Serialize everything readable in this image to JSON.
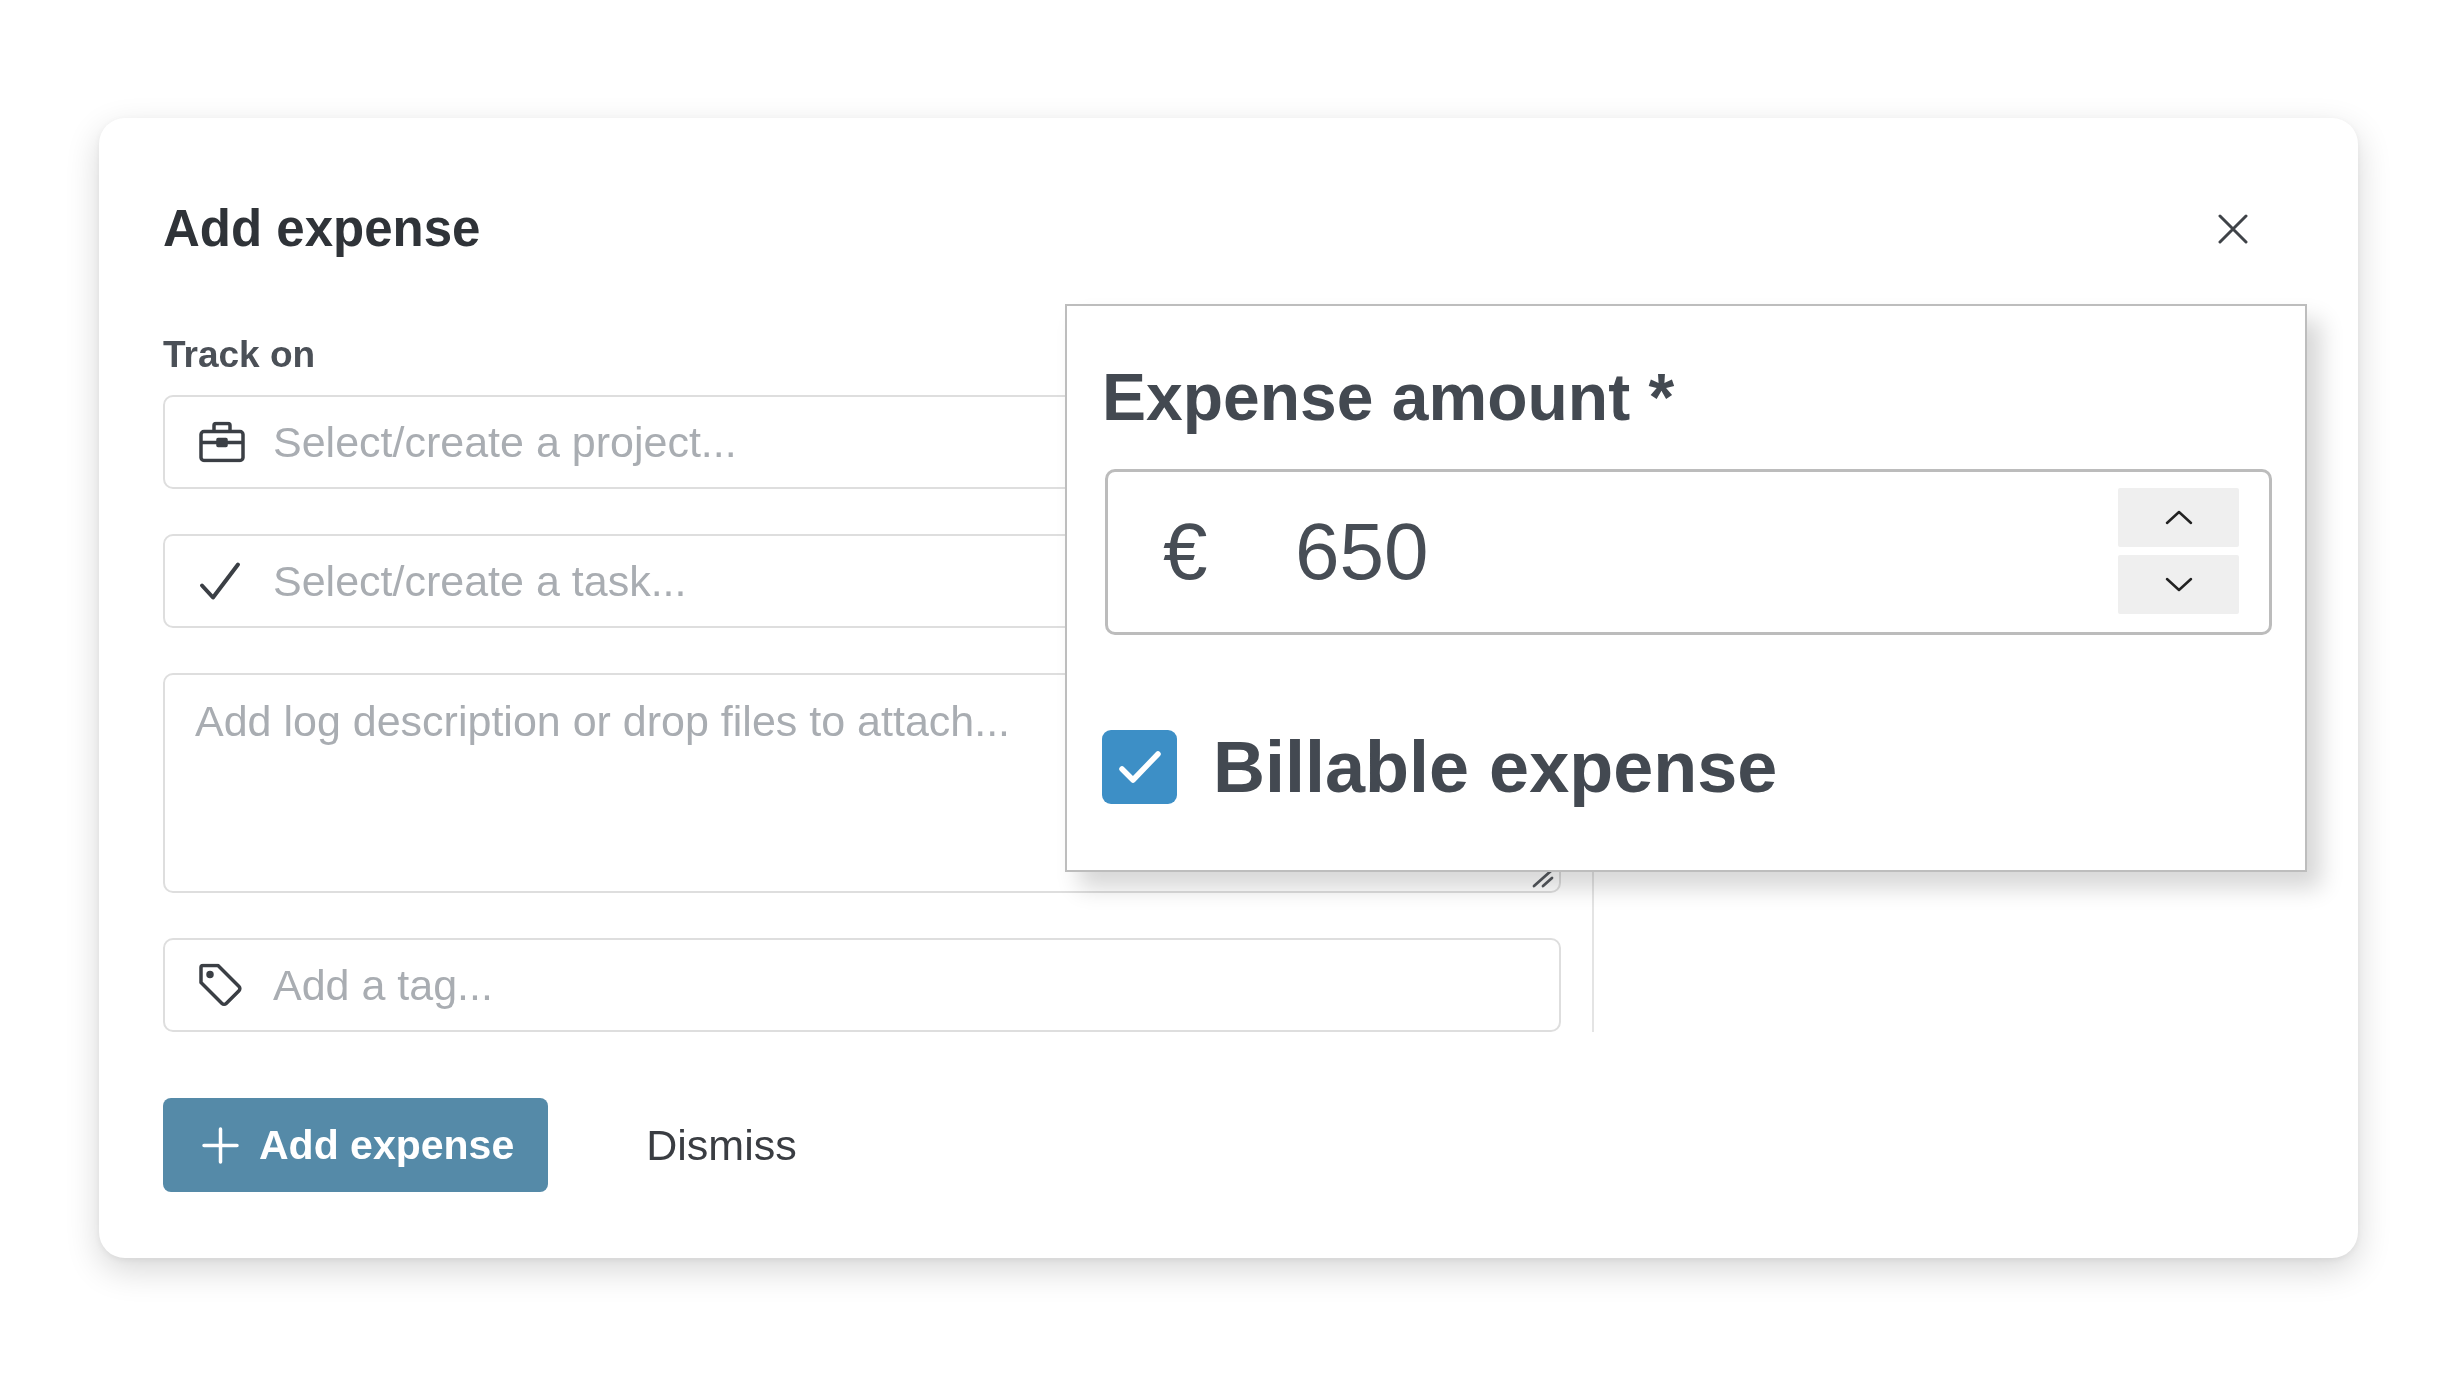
{
  "dialog": {
    "title": "Add expense"
  },
  "track_on": {
    "label": "Track on"
  },
  "fields": [
    {
      "kind": "project",
      "placeholder": "Select/create a project..."
    },
    {
      "kind": "task",
      "placeholder": "Select/create a task..."
    },
    {
      "kind": "description",
      "placeholder": "Add log description or drop files to attach..."
    },
    {
      "kind": "tag",
      "placeholder": "Add a tag..."
    }
  ],
  "amount_popover": {
    "label": "Expense amount *",
    "currency": "€",
    "value": "650",
    "billable": {
      "label": "Billable expense",
      "checked": true
    }
  },
  "buttons": [
    {
      "kind": "primary",
      "label": "Add expense"
    },
    {
      "kind": "secondary",
      "label": "Dismiss"
    }
  ]
}
